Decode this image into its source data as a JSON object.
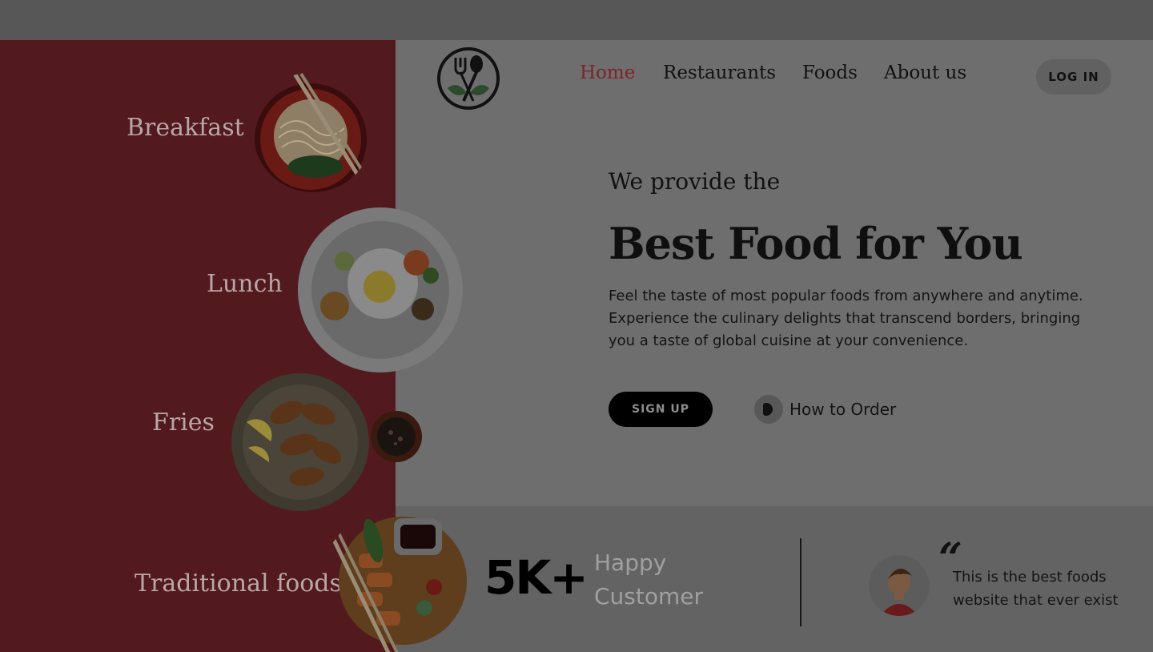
{
  "categories": [
    "Breakfast",
    "Lunch",
    "Fries",
    "Traditional foods"
  ],
  "nav": {
    "links": [
      "Home",
      "Restaurants",
      "Foods",
      "About us"
    ],
    "active": "Home",
    "login_label": "LOG IN"
  },
  "hero": {
    "subtitle": "We provide the",
    "title": "Best Food for You",
    "description": "Feel the taste of most popular foods from anywhere and anytime. Experience the culinary delights that transcend borders, bringing you a taste of global cuisine at your convenience.",
    "signup_label": "SIGN UP",
    "how_to_order_label": "How to Order"
  },
  "stats": {
    "value": "5K+",
    "label": "Happy Customer"
  },
  "testimonial": {
    "quote_mark": "“",
    "text": "This is the best foods website that ever exist"
  },
  "colors": {
    "left_panel": "#521a1e",
    "active_nav": "#7d2329",
    "button_dark": "#000000"
  },
  "icons": {
    "logo": "fork-spoon-leaves-logo-icon",
    "play": "play-icon",
    "avatar": "user-avatar"
  }
}
